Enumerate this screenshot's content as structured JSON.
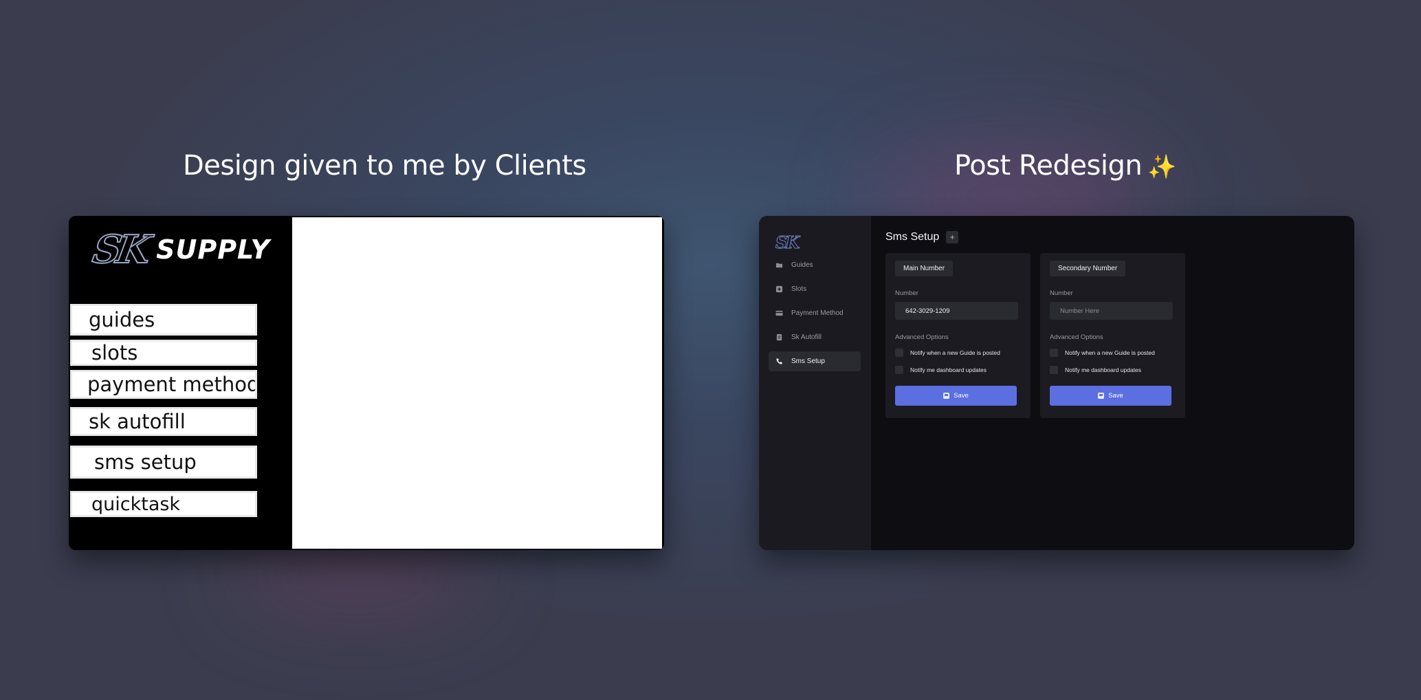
{
  "headings": {
    "left": "Design given to me by Clients",
    "right": "Post Redesign",
    "right_emoji": "✨"
  },
  "old_design": {
    "logo_mark": "SK",
    "logo_text": "SUPPLY",
    "nav_items": [
      "guides",
      "slots",
      "payment method",
      "sk autofill",
      "sms setup",
      "quicktask"
    ]
  },
  "new_design": {
    "logo_mark": "SK",
    "sidebar": {
      "items": [
        {
          "label": "Guides",
          "icon": "folder-icon"
        },
        {
          "label": "Slots",
          "icon": "plus-square-icon"
        },
        {
          "label": "Payment Method",
          "icon": "credit-card-icon"
        },
        {
          "label": "Sk Autofill",
          "icon": "document-icon"
        },
        {
          "label": "Sms Setup",
          "icon": "phone-icon",
          "active": true
        }
      ]
    },
    "page_title": "Sms Setup",
    "add_button": "+",
    "cards": [
      {
        "badge": "Main Number",
        "number_label": "Number",
        "number_value": "642-3029-1209",
        "number_placeholder": "",
        "advanced_label": "Advanced Options",
        "options": [
          "Notify when a new Guide is posted",
          "Notify me dashboard updates"
        ],
        "save_label": "Save"
      },
      {
        "badge": "Secondary Number",
        "number_label": "Number",
        "number_value": "",
        "number_placeholder": "Number Here",
        "advanced_label": "Advanced Options",
        "options": [
          "Notify when a new Guide is posted",
          "Notify me dashboard updates"
        ],
        "save_label": "Save"
      }
    ]
  },
  "colors": {
    "accent": "#5b6fe0",
    "sidebar_bg": "#1b1a20",
    "main_bg": "#0e0e12"
  }
}
